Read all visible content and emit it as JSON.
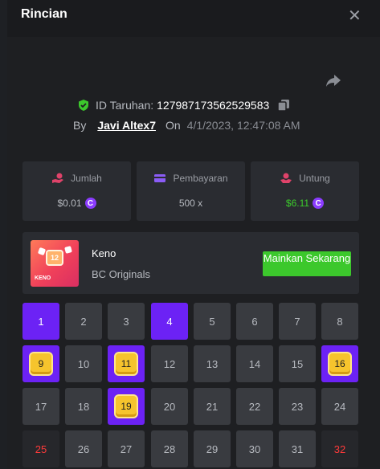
{
  "header": {
    "title": "Rincian"
  },
  "bet": {
    "id_label": "ID Taruhan:",
    "id_value": "127987173562529583",
    "by_label": "By",
    "user": "Javi Altex7",
    "on_label": "On",
    "date": "4/1/2023, 12:47:08 AM"
  },
  "stats": [
    {
      "label": "Jumlah",
      "value": "$0.01",
      "coin": "C",
      "color": "#e0436a"
    },
    {
      "label": "Pembayaran",
      "value": "500 x",
      "color": "#8b5cf6"
    },
    {
      "label": "Untung",
      "value": "$6.11",
      "coin": "C",
      "color": "#e0436a"
    }
  ],
  "game": {
    "thumb_number": "12",
    "thumb_word": "KENO",
    "name": "Keno",
    "provider": "BC Originals",
    "play_label": "Mainkan Sekarang",
    "play_color": "#3cc82c"
  },
  "grid": {
    "numbers": [
      "1",
      "2",
      "3",
      "4",
      "5",
      "6",
      "7",
      "8",
      "9",
      "10",
      "11",
      "12",
      "13",
      "14",
      "15",
      "16",
      "17",
      "18",
      "19",
      "20",
      "21",
      "22",
      "23",
      "24",
      "25",
      "26",
      "27",
      "28",
      "29",
      "30",
      "31",
      "32"
    ],
    "selected": [
      "1",
      "4",
      "9",
      "11",
      "16",
      "19"
    ],
    "hits": [
      "9",
      "11",
      "16",
      "19"
    ],
    "red_dark": [
      "25",
      "32"
    ],
    "selected_color": "#6c22f5",
    "hit_color": "#f6c42d"
  }
}
